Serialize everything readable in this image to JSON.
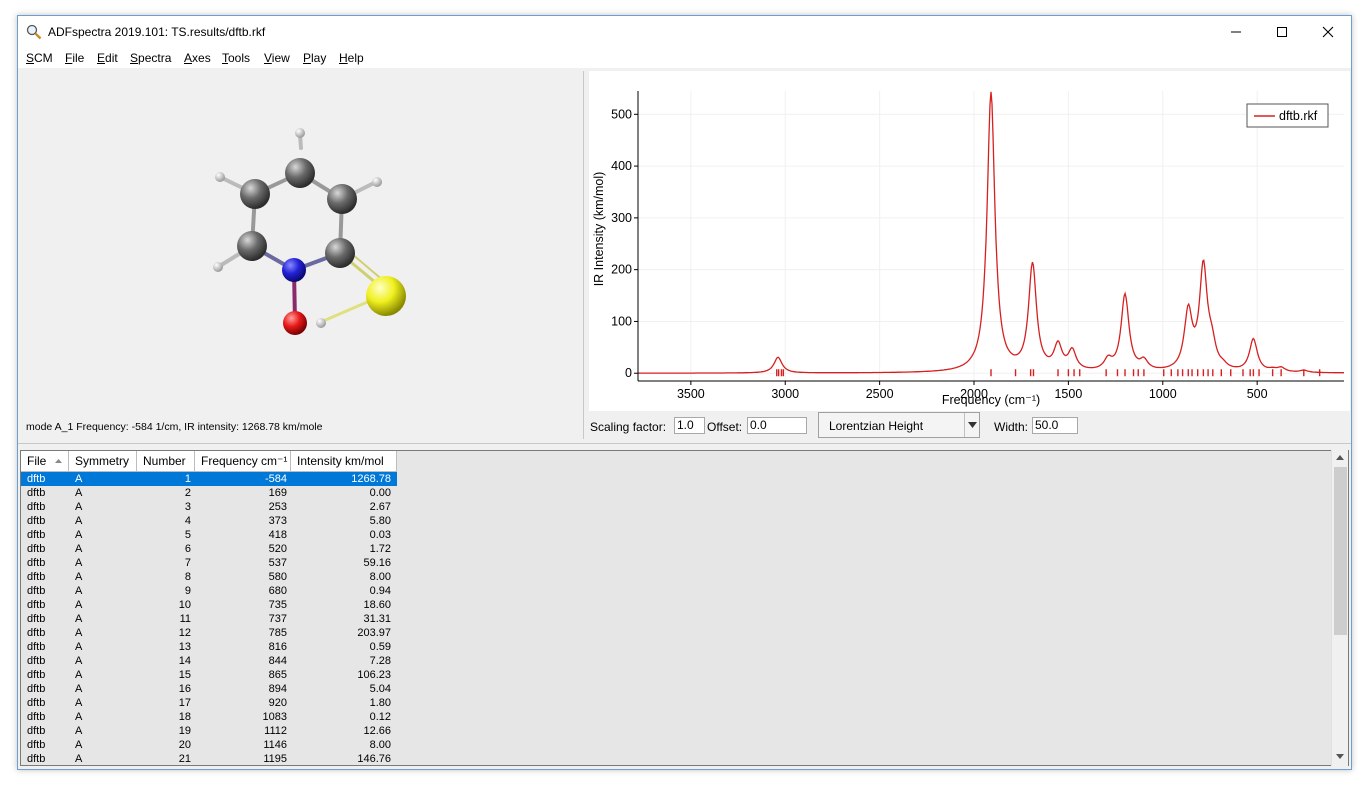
{
  "window": {
    "title": "ADFspectra 2019.101: TS.results/dftb.rkf",
    "app_icon": "magnifier-icon",
    "buttons": [
      "minimize-icon",
      "maximize-icon",
      "close-icon"
    ]
  },
  "menu": [
    {
      "label": "SCM"
    },
    {
      "label": "File"
    },
    {
      "label": "Edit"
    },
    {
      "label": "Spectra"
    },
    {
      "label": "Axes"
    },
    {
      "label": "Tools"
    },
    {
      "label": "View"
    },
    {
      "label": "Play"
    },
    {
      "label": "Help"
    }
  ],
  "molecule": {
    "status": "mode A_1 Frequency: -584 1/cm, IR intensity: 1268.78 km/mole",
    "colors": {
      "carbon": "#666666",
      "hydrogen": "#ffffff",
      "nitrogen": "#2323d8",
      "oxygen": "#e81a1a",
      "sulfur": "#f0f020"
    }
  },
  "chart_data": {
    "type": "line",
    "xlabel": "Frequency (cm⁻¹)",
    "ylabel": "IR Intensity (km/mol)",
    "xlim": [
      3780,
      40
    ],
    "ylim": [
      -15,
      545
    ],
    "x_ticks": [
      3500,
      3000,
      2500,
      2000,
      1500,
      1000,
      500
    ],
    "y_ticks": [
      0,
      100,
      200,
      300,
      400,
      500
    ],
    "legend": {
      "entries": [
        "dftb.rkf"
      ],
      "placement": "top-right"
    },
    "line_color": "#d62020",
    "peaks": [
      {
        "x": 3040,
        "y": 25
      },
      {
        "x": 3030,
        "y": 6
      },
      {
        "x": 1910,
        "y": 540
      },
      {
        "x": 1690,
        "y": 205
      },
      {
        "x": 1555,
        "y": 48
      },
      {
        "x": 1480,
        "y": 38
      },
      {
        "x": 1290,
        "y": 20
      },
      {
        "x": 1200,
        "y": 148
      },
      {
        "x": 1100,
        "y": 18
      },
      {
        "x": 865,
        "y": 112
      },
      {
        "x": 785,
        "y": 198
      },
      {
        "x": 740,
        "y": 40
      },
      {
        "x": 680,
        "y": 6
      },
      {
        "x": 520,
        "y": 63
      },
      {
        "x": 418,
        "y": 4
      },
      {
        "x": 373,
        "y": 8
      },
      {
        "x": 253,
        "y": 4
      }
    ],
    "width": 50,
    "sticks": [
      3045,
      3035,
      3020,
      3010,
      1910,
      1780,
      1700,
      1685,
      1555,
      1500,
      1470,
      1440,
      1300,
      1240,
      1200,
      1155,
      1130,
      1100,
      995,
      955,
      920,
      895,
      865,
      845,
      815,
      785,
      760,
      735,
      690,
      640,
      575,
      537,
      520,
      490,
      418,
      373,
      253,
      169
    ]
  },
  "controls": {
    "scaling_label": "Scaling factor:",
    "scaling_value": "1.0",
    "offset_label": "Offset:",
    "offset_value": "0.0",
    "lineshape_value": "Lorentzian Height",
    "width_label": "Width:",
    "width_value": "50.0"
  },
  "table": {
    "headers": [
      "File",
      "Symmetry",
      "Number",
      "Frequency cm⁻¹",
      "Intensity km/mol"
    ],
    "rows": [
      [
        "dftb",
        "A",
        "1",
        "-584",
        "1268.78"
      ],
      [
        "dftb",
        "A",
        "2",
        "169",
        "0.00"
      ],
      [
        "dftb",
        "A",
        "3",
        "253",
        "2.67"
      ],
      [
        "dftb",
        "A",
        "4",
        "373",
        "5.80"
      ],
      [
        "dftb",
        "A",
        "5",
        "418",
        "0.03"
      ],
      [
        "dftb",
        "A",
        "6",
        "520",
        "1.72"
      ],
      [
        "dftb",
        "A",
        "7",
        "537",
        "59.16"
      ],
      [
        "dftb",
        "A",
        "8",
        "580",
        "8.00"
      ],
      [
        "dftb",
        "A",
        "9",
        "680",
        "0.94"
      ],
      [
        "dftb",
        "A",
        "10",
        "735",
        "18.60"
      ],
      [
        "dftb",
        "A",
        "11",
        "737",
        "31.31"
      ],
      [
        "dftb",
        "A",
        "12",
        "785",
        "203.97"
      ],
      [
        "dftb",
        "A",
        "13",
        "816",
        "0.59"
      ],
      [
        "dftb",
        "A",
        "14",
        "844",
        "7.28"
      ],
      [
        "dftb",
        "A",
        "15",
        "865",
        "106.23"
      ],
      [
        "dftb",
        "A",
        "16",
        "894",
        "5.04"
      ],
      [
        "dftb",
        "A",
        "17",
        "920",
        "1.80"
      ],
      [
        "dftb",
        "A",
        "18",
        "1083",
        "0.12"
      ],
      [
        "dftb",
        "A",
        "19",
        "1112",
        "12.66"
      ],
      [
        "dftb",
        "A",
        "20",
        "1146",
        "8.00"
      ],
      [
        "dftb",
        "A",
        "21",
        "1195",
        "146.76"
      ]
    ]
  }
}
